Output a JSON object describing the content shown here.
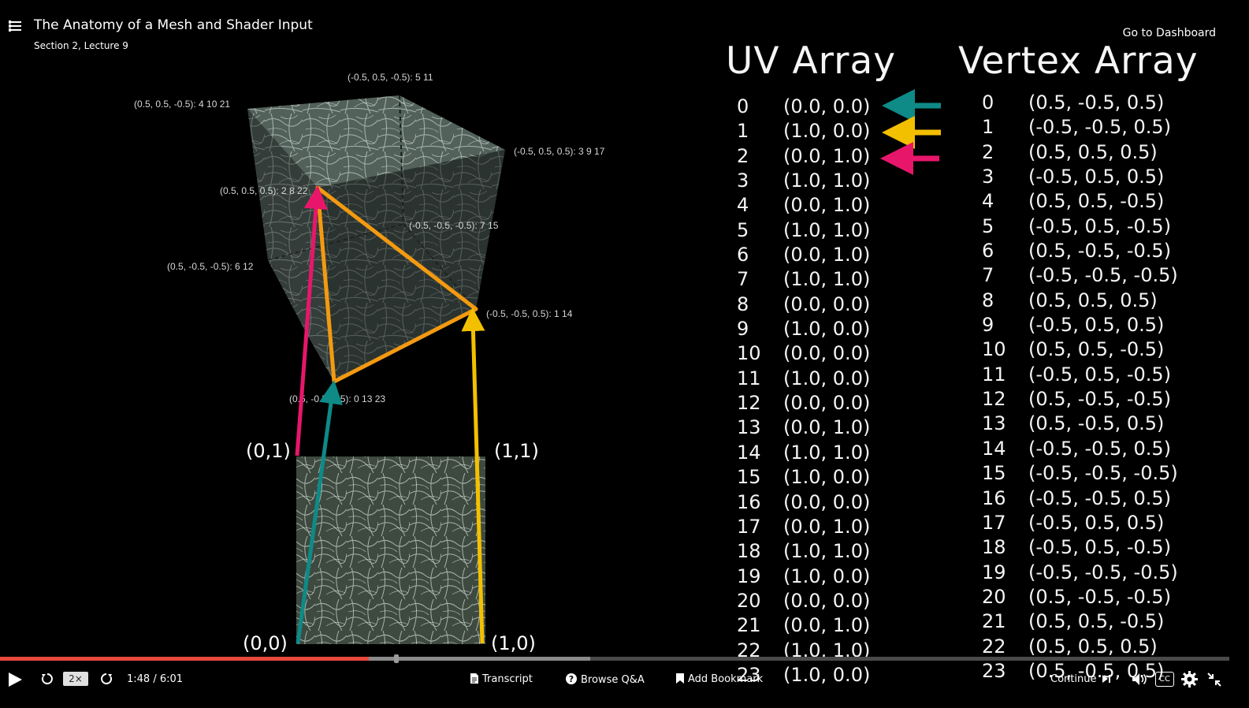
{
  "header": {
    "title": "The Anatomy of a Mesh and Shader Input",
    "subtitle": "Section 2, Lecture 9",
    "dashboard_link": "Go to Dashboard"
  },
  "slide": {
    "uv_title": "UV Array",
    "vertex_title": "Vertex Array",
    "uv_indices": [
      "0",
      "1",
      "2",
      "3",
      "4",
      "5",
      "6",
      "7",
      "8",
      "9",
      "10",
      "11",
      "12",
      "13",
      "14",
      "15",
      "16",
      "17",
      "18",
      "19",
      "20",
      "21",
      "22",
      "23"
    ],
    "uv_values": [
      "(0.0, 0.0)",
      "(1.0, 0.0)",
      "(0.0, 1.0)",
      "(1.0, 1.0)",
      "(0.0, 1.0)",
      "(1.0, 1.0)",
      "(0.0, 1.0)",
      "(1.0, 1.0)",
      "(0.0, 0.0)",
      "(1.0, 0.0)",
      "(0.0, 0.0)",
      "(1.0, 0.0)",
      "(0.0, 0.0)",
      "(0.0, 1.0)",
      "(1.0, 1.0)",
      "(1.0, 0.0)",
      "(0.0, 0.0)",
      "(0.0, 1.0)",
      "(1.0, 1.0)",
      "(1.0, 0.0)",
      "(0.0, 0.0)",
      "(0.0, 1.0)",
      "(1.0, 1.0)",
      "(1.0, 0.0)"
    ],
    "vertex_indices": [
      "0",
      "1",
      "2",
      "3",
      "4",
      "5",
      "6",
      "7",
      "8",
      "9",
      "10",
      "11",
      "12",
      "13",
      "14",
      "15",
      "16",
      "17",
      "18",
      "19",
      "20",
      "21",
      "22",
      "23"
    ],
    "vertex_values": [
      "(0.5, -0.5, 0.5)",
      "(-0.5, -0.5, 0.5)",
      "(0.5, 0.5, 0.5)",
      "(-0.5, 0.5, 0.5)",
      "(0.5, 0.5, -0.5)",
      "(-0.5, 0.5, -0.5)",
      "(0.5, -0.5, -0.5)",
      "(-0.5, -0.5, -0.5)",
      "(0.5, 0.5, 0.5)",
      "(-0.5, 0.5, 0.5)",
      "(0.5, 0.5, -0.5)",
      "(-0.5, 0.5, -0.5)",
      "(0.5, -0.5, -0.5)",
      "(0.5, -0.5, 0.5)",
      "(-0.5, -0.5, 0.5)",
      "(-0.5, -0.5, -0.5)",
      "(-0.5, -0.5, 0.5)",
      "(-0.5, 0.5, 0.5)",
      "(-0.5, 0.5, -0.5)",
      "(-0.5, -0.5, -0.5)",
      "(0.5, -0.5, -0.5)",
      "(0.5, 0.5, -0.5)",
      "(0.5, 0.5, 0.5)",
      "(0.5, -0.5, 0.5)"
    ],
    "cube_labels": {
      "top_back": "(-0.5, 0.5, -0.5): 5 11",
      "top_left": "(0.5, 0.5, -0.5): 4 10 21",
      "top_right": "(-0.5, 0.5, 0.5): 3 9 17",
      "front_top": "(0.5, 0.5, 0.5): 2 8 22",
      "back_mid": "(-0.5, -0.5, -0.5): 7 15",
      "left_mid": "(0.5, -0.5, -0.5): 6 12",
      "right_bottom": "(-0.5, -0.5, 0.5): 1 14",
      "front_bottom": "(0.5, -0.5, 0.5): 0 13 23"
    },
    "uv_corners": {
      "top_left": "(0,1)",
      "top_right": "(1,1)",
      "bottom_left": "(0,0)",
      "bottom_right": "(1,0)"
    },
    "colors": {
      "teal": "#0e8a87",
      "yellow": "#f3c000",
      "pink": "#e8166a",
      "orange": "#f39a10"
    }
  },
  "player": {
    "progress": 0.3,
    "buffered": 0.48,
    "speed": "2×",
    "time": "1:48 / 6:01",
    "transcript": "Transcript",
    "qa": "Browse Q&A",
    "bookmark": "Add Bookmark",
    "continue": "Continue"
  }
}
